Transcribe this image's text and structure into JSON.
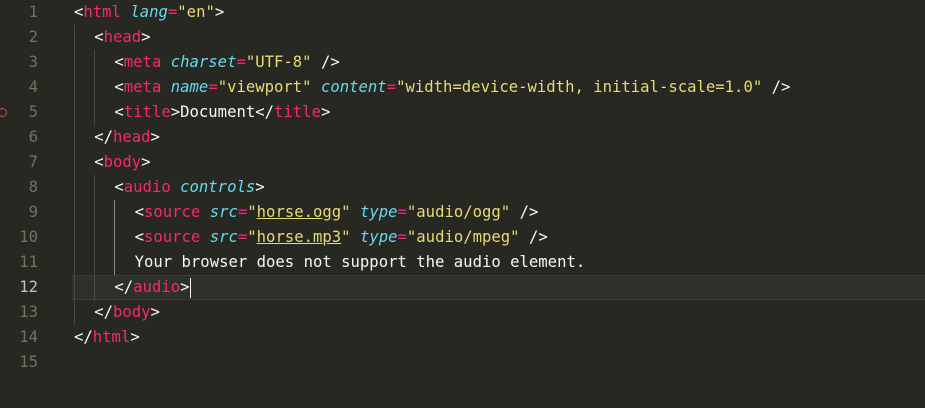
{
  "editor": {
    "current_line": 12,
    "breakpoint_line": 5,
    "lines": [
      {
        "num": "1",
        "tokens": [
          [
            "punc",
            "<"
          ],
          [
            "tag",
            "html"
          ],
          [
            "punc",
            " "
          ],
          [
            "attr",
            "lang"
          ],
          [
            "eq",
            "="
          ],
          [
            "str",
            "\"en\""
          ],
          [
            "punc",
            ">"
          ]
        ]
      },
      {
        "num": "2",
        "tokens": [
          [
            "punc",
            "<"
          ],
          [
            "tag",
            "head"
          ],
          [
            "punc",
            ">"
          ]
        ]
      },
      {
        "num": "3",
        "tokens": [
          [
            "punc",
            "<"
          ],
          [
            "tag",
            "meta"
          ],
          [
            "punc",
            " "
          ],
          [
            "attr",
            "charset"
          ],
          [
            "eq",
            "="
          ],
          [
            "str",
            "\"UTF-8\""
          ],
          [
            "punc",
            " />"
          ]
        ]
      },
      {
        "num": "4",
        "tokens": [
          [
            "punc",
            "<"
          ],
          [
            "tag",
            "meta"
          ],
          [
            "punc",
            " "
          ],
          [
            "attr",
            "name"
          ],
          [
            "eq",
            "="
          ],
          [
            "str",
            "\"viewport\""
          ],
          [
            "punc",
            " "
          ],
          [
            "attr",
            "content"
          ],
          [
            "eq",
            "="
          ],
          [
            "str",
            "\"width=device-width, initial-scale=1.0\""
          ],
          [
            "punc",
            " />"
          ]
        ]
      },
      {
        "num": "5",
        "tokens": [
          [
            "punc",
            "<"
          ],
          [
            "tag",
            "title"
          ],
          [
            "punc",
            ">"
          ],
          [
            "text",
            "Document"
          ],
          [
            "punc",
            "</"
          ],
          [
            "tag",
            "title"
          ],
          [
            "punc",
            ">"
          ]
        ]
      },
      {
        "num": "6",
        "tokens": [
          [
            "punc",
            "</"
          ],
          [
            "tag",
            "head"
          ],
          [
            "punc",
            ">"
          ]
        ]
      },
      {
        "num": "7",
        "tokens": [
          [
            "punc",
            "<"
          ],
          [
            "tag",
            "body"
          ],
          [
            "punc",
            ">"
          ]
        ]
      },
      {
        "num": "8",
        "tokens": [
          [
            "punc",
            "<"
          ],
          [
            "tag",
            "audio"
          ],
          [
            "punc",
            " "
          ],
          [
            "attr",
            "controls"
          ],
          [
            "punc",
            ">"
          ]
        ]
      },
      {
        "num": "9",
        "tokens": [
          [
            "punc",
            "<"
          ],
          [
            "tag",
            "source"
          ],
          [
            "punc",
            " "
          ],
          [
            "attr",
            "src"
          ],
          [
            "eq",
            "="
          ],
          [
            "str",
            "\""
          ],
          [
            "strlink",
            "horse.ogg"
          ],
          [
            "str",
            "\""
          ],
          [
            "punc",
            " "
          ],
          [
            "attr",
            "type"
          ],
          [
            "eq",
            "="
          ],
          [
            "str",
            "\"audio/ogg\""
          ],
          [
            "punc",
            " />"
          ]
        ]
      },
      {
        "num": "10",
        "tokens": [
          [
            "punc",
            "<"
          ],
          [
            "tag",
            "source"
          ],
          [
            "punc",
            " "
          ],
          [
            "attr",
            "src"
          ],
          [
            "eq",
            "="
          ],
          [
            "str",
            "\""
          ],
          [
            "strlink",
            "horse.mp3"
          ],
          [
            "str",
            "\""
          ],
          [
            "punc",
            " "
          ],
          [
            "attr",
            "type"
          ],
          [
            "eq",
            "="
          ],
          [
            "str",
            "\"audio/mpeg\""
          ],
          [
            "punc",
            " />"
          ]
        ]
      },
      {
        "num": "11",
        "tokens": [
          [
            "text",
            "Your browser does not support the audio element."
          ]
        ]
      },
      {
        "num": "12",
        "tokens": [
          [
            "punc",
            "</"
          ],
          [
            "tag",
            "audio"
          ],
          [
            "punc",
            ">"
          ]
        ]
      },
      {
        "num": "13",
        "tokens": [
          [
            "punc",
            "</"
          ],
          [
            "tag",
            "body"
          ],
          [
            "punc",
            ">"
          ]
        ]
      },
      {
        "num": "14",
        "tokens": [
          [
            "punc",
            "</"
          ],
          [
            "tag",
            "html"
          ],
          [
            "punc",
            ">"
          ]
        ]
      },
      {
        "num": "15",
        "tokens": []
      }
    ]
  },
  "colors": {
    "background": "#272822",
    "tag": "#f92672",
    "attribute": "#66d9ef",
    "string": "#e6db74",
    "text": "#f8f8f2",
    "line_number": "#75715e"
  }
}
